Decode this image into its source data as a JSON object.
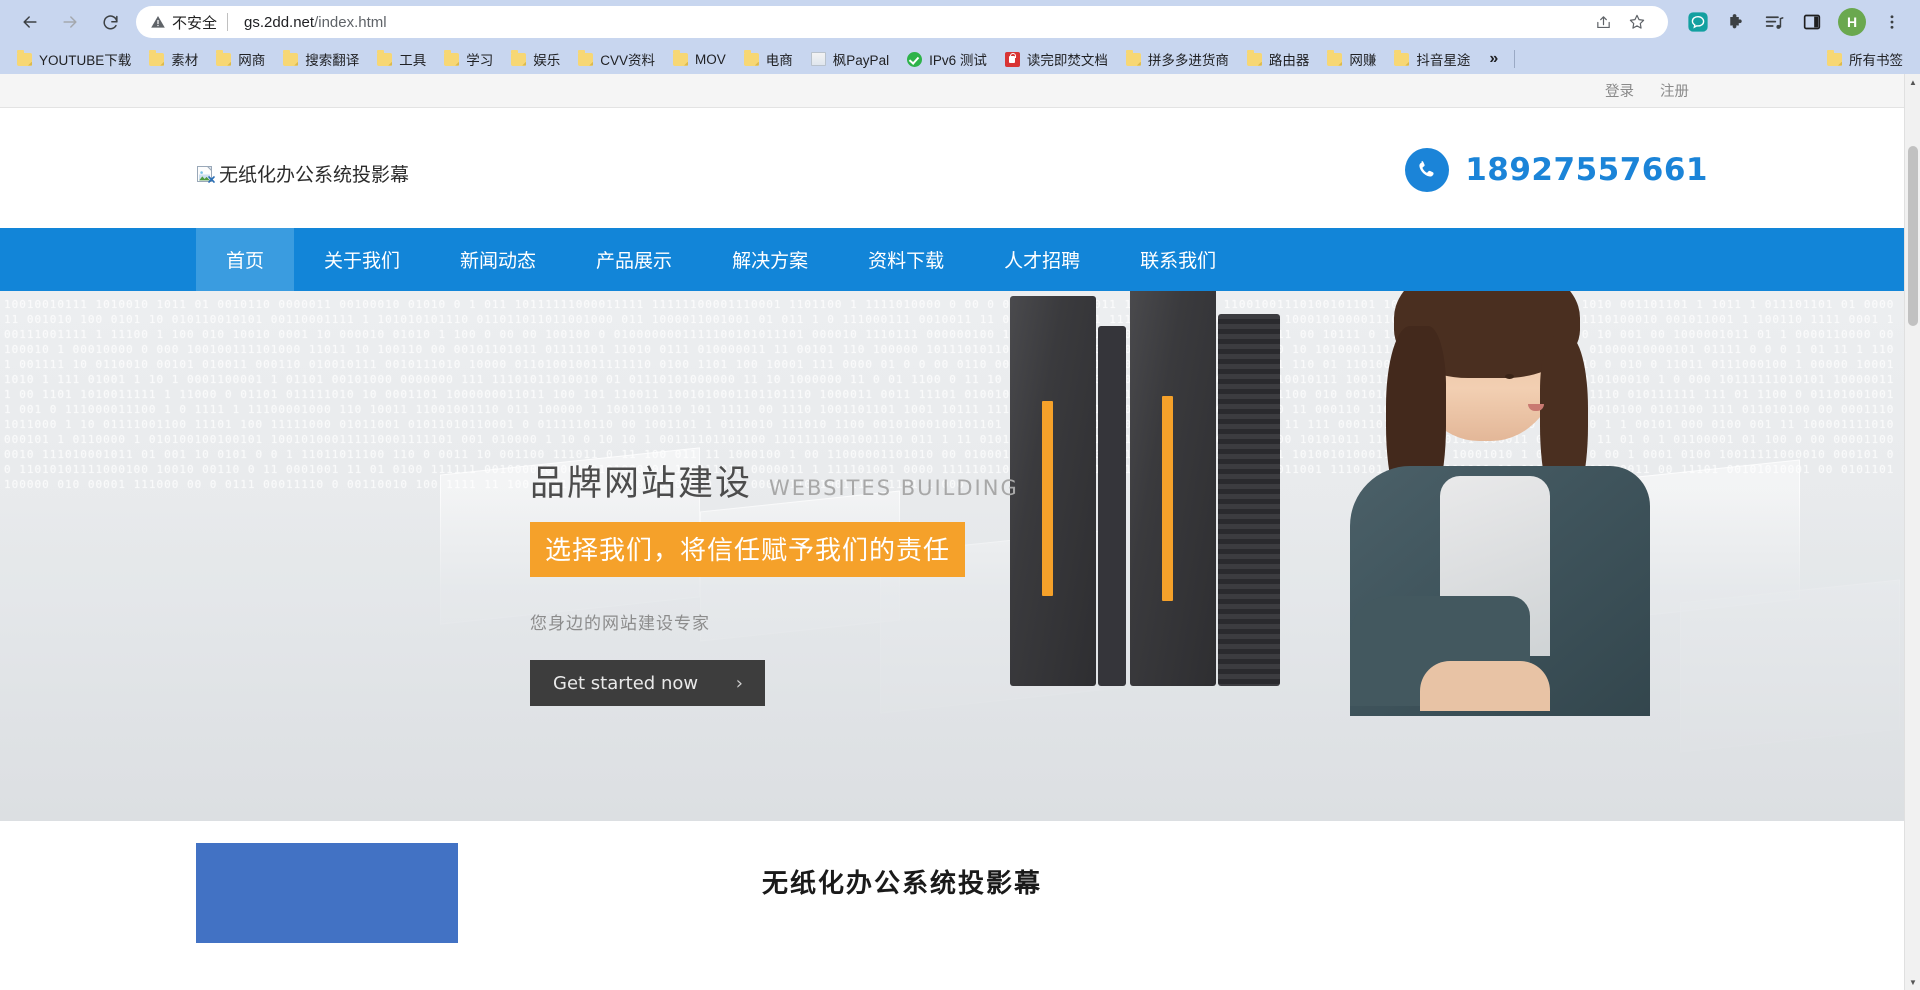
{
  "browser": {
    "back_label": "back-arrow",
    "forward_label": "forward-arrow",
    "reload_label": "reload",
    "security_text": "不安全",
    "url_domain": "gs.2dd.net",
    "url_path": "/index.html",
    "url_full": "gs.2dd.net/index.html",
    "share_icon": "share-icon",
    "bookmark_star_icon": "star-icon",
    "chat_icon": "chat-bubble-icon",
    "extensions_icon": "puzzle-piece-icon",
    "media_icon": "media-playlist-icon",
    "sidepanel_icon": "side-panel-icon",
    "avatar_initial": "H",
    "menu_icon": "three-dot-menu-icon"
  },
  "bookmarks": {
    "items": [
      {
        "label": "YOUTUBE下载",
        "icon": "folder"
      },
      {
        "label": "素材",
        "icon": "folder"
      },
      {
        "label": "网商",
        "icon": "folder"
      },
      {
        "label": "搜索翻译",
        "icon": "folder"
      },
      {
        "label": "工具",
        "icon": "folder"
      },
      {
        "label": "学习",
        "icon": "folder"
      },
      {
        "label": "娱乐",
        "icon": "folder"
      },
      {
        "label": "CVV资料",
        "icon": "folder"
      },
      {
        "label": "MOV",
        "icon": "folder"
      },
      {
        "label": "电商",
        "icon": "folder"
      },
      {
        "label": "枫PayPal",
        "icon": "doc"
      },
      {
        "label": "IPv6 测试",
        "icon": "check"
      },
      {
        "label": "读完即焚文档",
        "icon": "lock"
      },
      {
        "label": "拼多多进货商",
        "icon": "folder"
      },
      {
        "label": "路由器",
        "icon": "folder"
      },
      {
        "label": "网赚",
        "icon": "folder"
      },
      {
        "label": "抖音星途",
        "icon": "folder"
      }
    ],
    "overflow_label": "»",
    "all_bookmarks_label": "所有书签"
  },
  "page": {
    "utility": {
      "login_label": "登录",
      "register_label": "注册"
    },
    "header": {
      "logo_alt_text": "无纸化办公系统投影幕",
      "logo_icon": "broken-image-icon",
      "phone_icon": "phone-icon",
      "phone_number": "18927557661"
    },
    "nav": {
      "items": [
        {
          "label": "首页",
          "active": true
        },
        {
          "label": "关于我们",
          "active": false
        },
        {
          "label": "新闻动态",
          "active": false
        },
        {
          "label": "产品展示",
          "active": false
        },
        {
          "label": "解决方案",
          "active": false
        },
        {
          "label": "资料下载",
          "active": false
        },
        {
          "label": "人才招聘",
          "active": false
        },
        {
          "label": "联系我们",
          "active": false
        }
      ]
    },
    "banner": {
      "title_cn": "品牌网站建设",
      "title_en": "WEBSITES  BUILDING",
      "highlight": "选择我们，将信任赋予我们的责任",
      "subtitle": "您身边的网站建设专家",
      "cta_label": "Get started now",
      "cta_chevron": "›",
      "prev_arrow": "‹",
      "next_arrow": "›",
      "accent_orange": "#f5a12a",
      "accent_blue": "#1285d8"
    },
    "section": {
      "title": "无纸化办公系统投影幕",
      "thumb_color": "#4272c4"
    }
  }
}
